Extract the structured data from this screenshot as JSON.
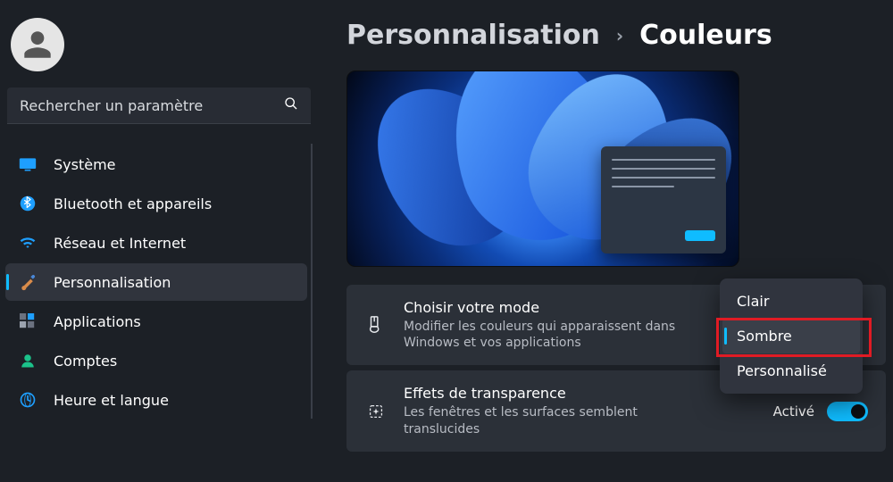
{
  "search": {
    "placeholder": "Rechercher un paramètre"
  },
  "nav": {
    "items": [
      {
        "label": "Système"
      },
      {
        "label": "Bluetooth et appareils"
      },
      {
        "label": "Réseau et Internet"
      },
      {
        "label": "Personnalisation"
      },
      {
        "label": "Applications"
      },
      {
        "label": "Comptes"
      },
      {
        "label": "Heure et langue"
      }
    ],
    "active_index": 3
  },
  "breadcrumb": {
    "parent": "Personnalisation",
    "separator": "›",
    "current": "Couleurs"
  },
  "settings": {
    "mode": {
      "title": "Choisir votre mode",
      "sub": "Modifier les couleurs qui apparaissent dans Windows et vos applications"
    },
    "transparency": {
      "title": "Effets de transparence",
      "sub": "Les fenêtres et les surfaces semblent translucides",
      "state_label": "Activé",
      "state": true
    }
  },
  "mode_options": {
    "items": [
      {
        "label": "Clair"
      },
      {
        "label": "Sombre"
      },
      {
        "label": "Personnalisé"
      }
    ],
    "selected_index": 1
  }
}
